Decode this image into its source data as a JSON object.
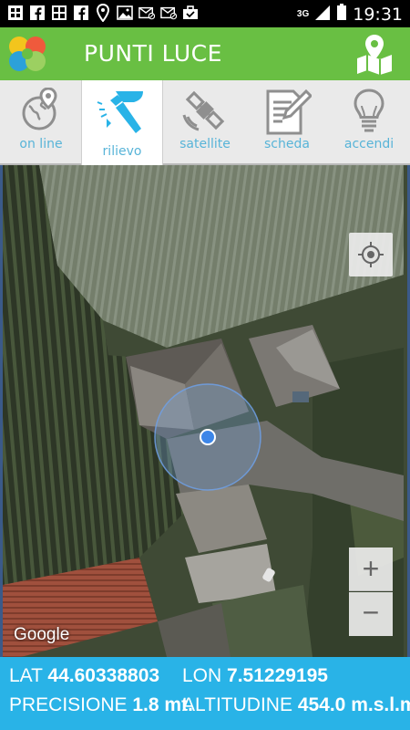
{
  "status_bar": {
    "time": "19:31",
    "network": "3G",
    "icons": [
      "grid-icon",
      "facebook-icon",
      "gallery-icon",
      "facebook-icon",
      "location-pin-icon",
      "image-icon",
      "mail-off-icon",
      "mail-off-icon",
      "briefcase-check-icon"
    ]
  },
  "header": {
    "title": "PUNTI LUCE",
    "brand_color": "#69bf43"
  },
  "tabs": [
    {
      "label": "on line",
      "icon": "globe-pin-icon"
    },
    {
      "label": "rilievo",
      "icon": "hammer-icon",
      "active": true
    },
    {
      "label": "satellite",
      "icon": "satellite-icon"
    },
    {
      "label": "scheda",
      "icon": "document-edit-icon"
    },
    {
      "label": "accendi",
      "icon": "lightbulb-icon"
    }
  ],
  "map": {
    "attribution": "Google",
    "zoom_in": "+",
    "zoom_out": "−"
  },
  "info": {
    "lat_label": "LAT",
    "lat_value": "44.60338803",
    "lon_label": "LON",
    "lon_value": "7.51229195",
    "precision_label": "PRECISIONE",
    "precision_value": "1.8 mt.",
    "altitude_label": "ALTITUDINE",
    "altitude_value": "454.0 m.s.l.m.",
    "accent_color": "#29b3e7"
  }
}
